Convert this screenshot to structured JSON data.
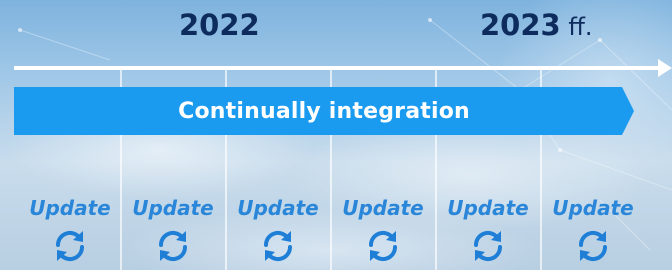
{
  "timeline": {
    "years": [
      {
        "year": "2022",
        "suffix": ""
      },
      {
        "year": "2023",
        "suffix": " ff."
      }
    ],
    "banner_label": "Continually integration",
    "updates": [
      "Update",
      "Update",
      "Update",
      "Update",
      "Update",
      "Update"
    ],
    "update_icon": "refresh-icon"
  },
  "colors": {
    "banner": "#1a9bf0",
    "year_text": "#0d2b5c",
    "update_text": "#2a86d8",
    "icon": "#1f7fd6"
  }
}
